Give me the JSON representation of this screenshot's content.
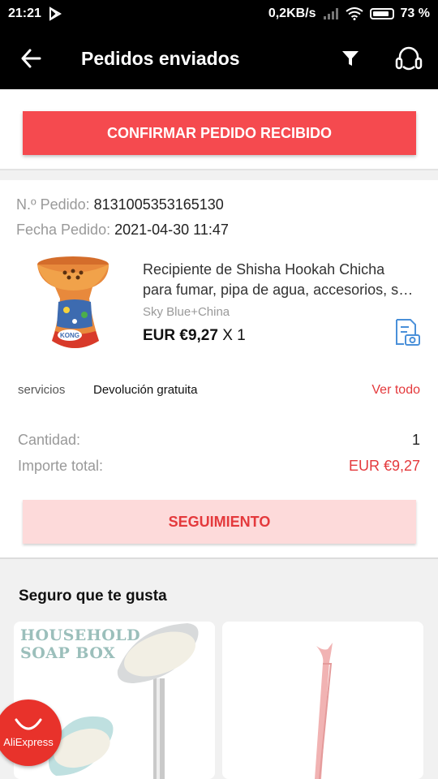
{
  "status_bar": {
    "time": "21:21",
    "network_speed": "0,2KB/s",
    "battery": "73 %"
  },
  "header": {
    "title": "Pedidos enviados"
  },
  "confirm": {
    "label": "CONFIRMAR PEDIDO RECIBIDO"
  },
  "order": {
    "number_label": "N.º Pedido:",
    "number": "8131005353165130",
    "date_label": "Fecha Pedido:",
    "date": "2021-04-30 11:47",
    "product": {
      "title_line1": "Recipiente de Shisha Hookah Chicha",
      "title_line2": "para fumar, pipa de agua, accesorios, soportes",
      "variant": "Sky Blue+China",
      "price": "EUR €9,27",
      "qty": "X 1",
      "image_text": "KONG"
    },
    "services_label": "servicios",
    "services_value": "Devolución gratuita",
    "view_all": "Ver todo",
    "quantity_label": "Cantidad:",
    "quantity": "1",
    "total_label": "Importe total:",
    "total": "EUR €9,27",
    "tracking_label": "SEGUIMIENTO"
  },
  "recommend": {
    "title": "Seguro que te gusta",
    "card1_text_line1": "HOUSEHOLD",
    "card1_text_line2": "SOAP BOX"
  },
  "aliexpress": {
    "label": "AliExpress"
  },
  "colors": {
    "primary_red": "#f54a4f",
    "price_red": "#e4393c",
    "light_red": "#fddada",
    "icon_blue": "#4a90d9"
  }
}
